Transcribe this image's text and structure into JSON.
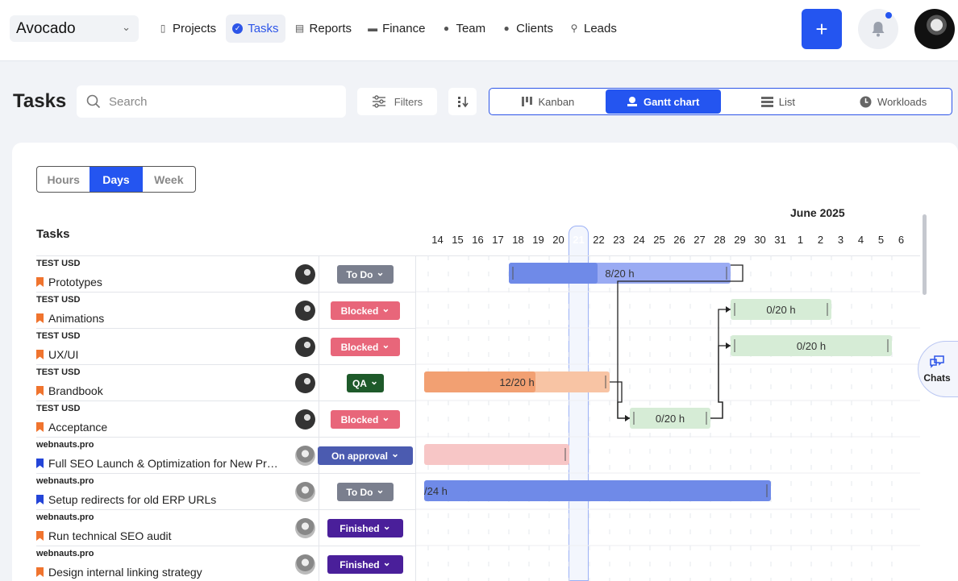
{
  "workspace": {
    "name": "Avocado"
  },
  "nav": [
    {
      "label": "Projects",
      "icon": "document-icon"
    },
    {
      "label": "Tasks",
      "icon": "check-circle-icon",
      "active": true
    },
    {
      "label": "Reports",
      "icon": "report-icon"
    },
    {
      "label": "Finance",
      "icon": "finance-icon"
    },
    {
      "label": "Team",
      "icon": "person-icon"
    },
    {
      "label": "Clients",
      "icon": "clients-icon"
    },
    {
      "label": "Leads",
      "icon": "leads-icon"
    }
  ],
  "page": {
    "title": "Tasks"
  },
  "search": {
    "placeholder": "Search"
  },
  "toolbar": {
    "filters_label": "Filters"
  },
  "views": [
    {
      "label": "Kanban",
      "icon": "kanban-icon"
    },
    {
      "label": "Gantt chart",
      "icon": "gantt-icon",
      "active": true
    },
    {
      "label": "List",
      "icon": "list-icon"
    },
    {
      "label": "Workloads",
      "icon": "clock-icon"
    }
  ],
  "scale": [
    {
      "label": "Hours"
    },
    {
      "label": "Days",
      "active": true
    },
    {
      "label": "Week"
    }
  ],
  "tasks_header": "Tasks",
  "timeline": {
    "month": "June 2025",
    "days": [
      "14",
      "15",
      "16",
      "17",
      "18",
      "19",
      "20",
      "21",
      "22",
      "23",
      "24",
      "25",
      "26",
      "27",
      "28",
      "29",
      "30",
      "31",
      "1",
      "2",
      "3",
      "4",
      "5",
      "6"
    ],
    "today": "21"
  },
  "tasks": [
    {
      "project": "TEST USD",
      "name": "Prototypes",
      "flag": "#f0742e",
      "status": "To Do",
      "status_color": "#7a7f8e",
      "avatar": "dark"
    },
    {
      "project": "TEST USD",
      "name": "Animations",
      "flag": "#f0742e",
      "status": "Blocked",
      "status_color": "#e8667a",
      "avatar": "dark"
    },
    {
      "project": "TEST USD",
      "name": "UX/UI",
      "flag": "#f0742e",
      "status": "Blocked",
      "status_color": "#e8667a",
      "avatar": "dark"
    },
    {
      "project": "TEST USD",
      "name": "Brandbook",
      "flag": "#f0742e",
      "status": "QA",
      "status_color": "#1e5a2a",
      "avatar": "dark"
    },
    {
      "project": "TEST USD",
      "name": "Acceptance",
      "flag": "#f0742e",
      "status": "Blocked",
      "status_color": "#e8667a",
      "avatar": "dark"
    },
    {
      "project": "webnauts.pro",
      "name": "Full SEO Launch & Optimization for New Pr…",
      "flag": "#2445d8",
      "status": "On approval",
      "status_color": "#4b5bb0",
      "avatar": "light"
    },
    {
      "project": "webnauts.pro",
      "name": "Setup redirects for old ERP URLs",
      "flag": "#2445d8",
      "status": "To Do",
      "status_color": "#7a7f8e",
      "avatar": "light"
    },
    {
      "project": "webnauts.pro",
      "name": "Run technical SEO audit",
      "flag": "#f0742e",
      "status": "Finished",
      "status_color": "#4a1f9a",
      "avatar": "light"
    },
    {
      "project": "webnauts.pro",
      "name": "Design internal linking strategy",
      "flag": "#f0742e",
      "status": "Finished",
      "status_color": "#4a1f9a",
      "avatar": "light"
    }
  ],
  "bars": [
    {
      "row": 0,
      "label": "8/20 h",
      "start": "18",
      "end": "28",
      "color": "#9aabf3",
      "fill": "#6f8ae8",
      "progress": 0.4
    },
    {
      "row": 1,
      "label": "0/20 h",
      "start": "29",
      "end": "2",
      "color": "#d6ecd6",
      "fill": "#d6ecd6",
      "progress": 0
    },
    {
      "row": 2,
      "label": "0/20 h",
      "start": "29",
      "end": "5",
      "color": "#d6ecd6",
      "fill": "#d6ecd6",
      "progress": 0
    },
    {
      "row": 3,
      "label": "12/20 h",
      "start": "14",
      "end": "22",
      "color": "#f8c4a4",
      "fill": "#f2a072",
      "progress": 0.6
    },
    {
      "row": 4,
      "label": "0/20 h",
      "start": "24",
      "end": "27",
      "color": "#d6ecd6",
      "fill": "#d6ecd6",
      "progress": 0
    },
    {
      "row": 5,
      "label": "",
      "start": "14",
      "end": "20",
      "color": "#f7c6c6",
      "fill": "#f7c6c6",
      "progress": 0
    },
    {
      "row": 6,
      "label": "/24 h",
      "start": "14",
      "end": "30",
      "color": "#6f8ae8",
      "fill": "#6f8ae8",
      "progress": 1
    }
  ],
  "chats": {
    "label": "Chats"
  }
}
